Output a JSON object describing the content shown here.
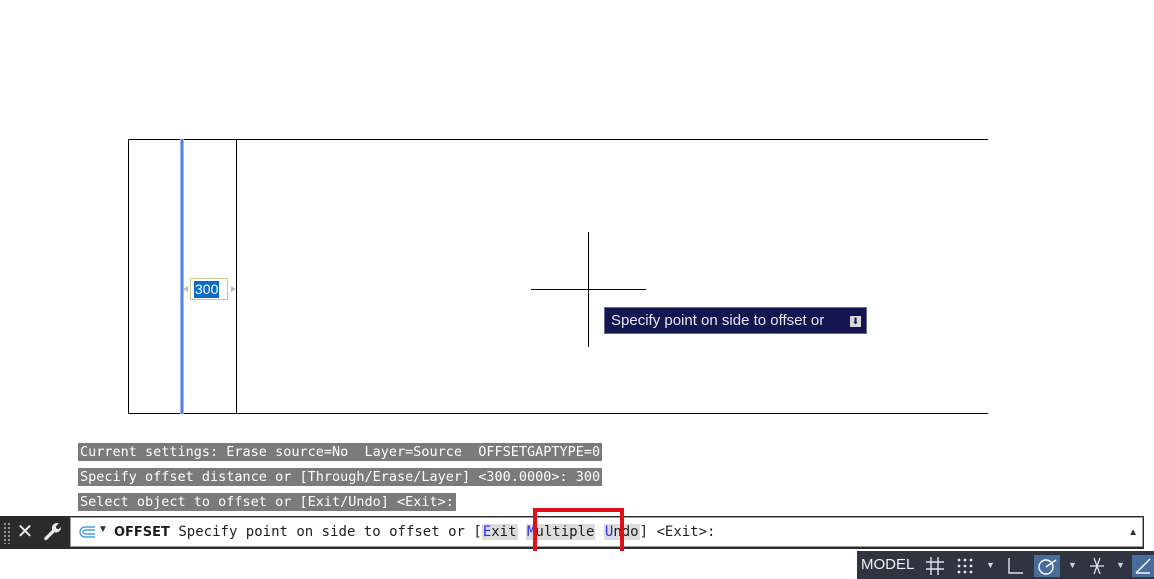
{
  "dynamic_input": {
    "value": "300"
  },
  "tooltip": {
    "text": "Specify point on side to offset or"
  },
  "history": [
    "Current settings: Erase source=No  Layer=Source  OFFSETGAPTYPE=0",
    "Specify offset distance or [Through/Erase/Layer] <300.0000>: 300",
    "Select object to offset or [Exit/Undo] <Exit>:"
  ],
  "command_line": {
    "command_name": "OFFSET",
    "prompt": " Specify point on side to offset or [",
    "options": [
      {
        "key": "E",
        "rest": "xit"
      },
      {
        "key": "M",
        "rest": "ultiple"
      },
      {
        "key": "U",
        "rest": "ndo"
      }
    ],
    "default": "] <Exit>:"
  },
  "status_bar": {
    "model_label": "MODEL",
    "icons": [
      "grid-icon",
      "snap-icon",
      "ortho-icon",
      "polar-tracking-icon",
      "isodraft-icon",
      "osnap-tracking-icon"
    ]
  },
  "colors": {
    "selected_line": "#3c6fd8",
    "tooltip_bg": "#141652",
    "history_bg": "#7b7b7b",
    "highlight_box": "#e0101a",
    "status_bg": "#2e3440"
  }
}
